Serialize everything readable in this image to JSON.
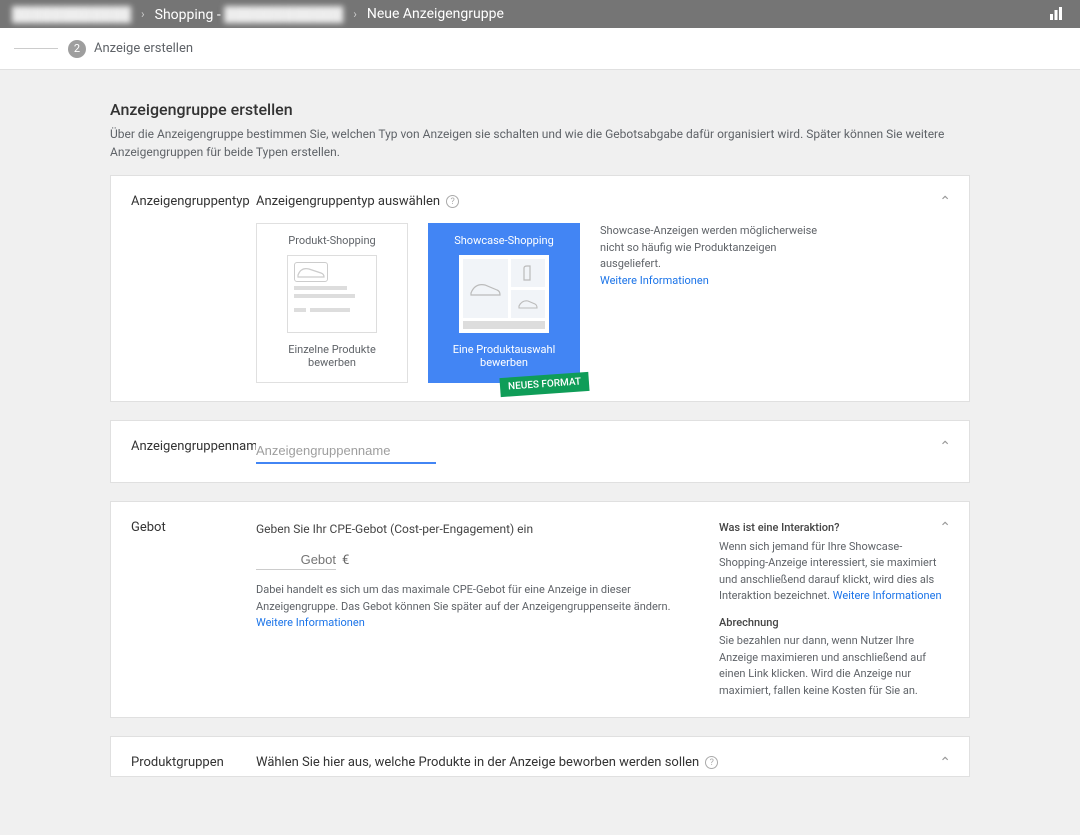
{
  "header": {
    "crumb1": "████████████",
    "crumb2_prefix": "Shopping -",
    "crumb2_blur": "████████████",
    "crumb3": "Neue Anzeigengruppe"
  },
  "stepper": {
    "number": "2",
    "label": "Anzeige erstellen"
  },
  "page": {
    "title": "Anzeigengruppe erstellen",
    "subtitle": "Über die Anzeigengruppe bestimmen Sie, welchen Typ von Anzeigen sie schalten und wie die Gebotsabgabe dafür organisiert wird. Später können Sie weitere Anzeigengruppen für beide Typen erstellen."
  },
  "type_panel": {
    "label": "Anzeigengruppentyp",
    "subhead": "Anzeigengruppentyp auswählen",
    "card_product": {
      "title": "Produkt-Shopping",
      "caption": "Einzelne Produkte bewerben"
    },
    "card_showcase": {
      "title": "Showcase-Shopping",
      "caption": "Eine Produktauswahl bewerben",
      "badge": "NEUES FORMAT"
    },
    "info_text": "Showcase-Anzeigen werden möglicherweise nicht so häufig wie Produktanzeigen ausgeliefert.",
    "info_link": "Weitere Informationen"
  },
  "name_panel": {
    "label": "Anzeigengruppenname",
    "placeholder": "Anzeigengruppenname"
  },
  "bid_panel": {
    "label": "Gebot",
    "instruction": "Geben Sie Ihr CPE-Gebot (Cost-per-Engagement) ein",
    "bid_placeholder": "Gebot",
    "currency": "€",
    "note": "Dabei handelt es sich um das maximale CPE-Gebot für eine Anzeige in dieser Anzeigengruppe. Das Gebot können Sie später auf der Anzeigengruppenseite ändern.",
    "note_link": "Weitere Informationen",
    "info1_head": "Was ist eine Interaktion?",
    "info1_body": "Wenn sich jemand für Ihre Showcase-Shopping-Anzeige interessiert, sie maximiert und anschließend darauf klickt, wird dies als Interaktion bezeichnet.",
    "info1_link": "Weitere Informationen",
    "info2_head": "Abrechnung",
    "info2_body": "Sie bezahlen nur dann, wenn Nutzer Ihre Anzeige maximieren und anschließend auf einen Link klicken. Wird die Anzeige nur maximiert, fallen keine Kosten für Sie an."
  },
  "productgroups_panel": {
    "label": "Produktgruppen",
    "instruction": "Wählen Sie hier aus, welche Produkte in der Anzeige beworben werden sollen"
  }
}
